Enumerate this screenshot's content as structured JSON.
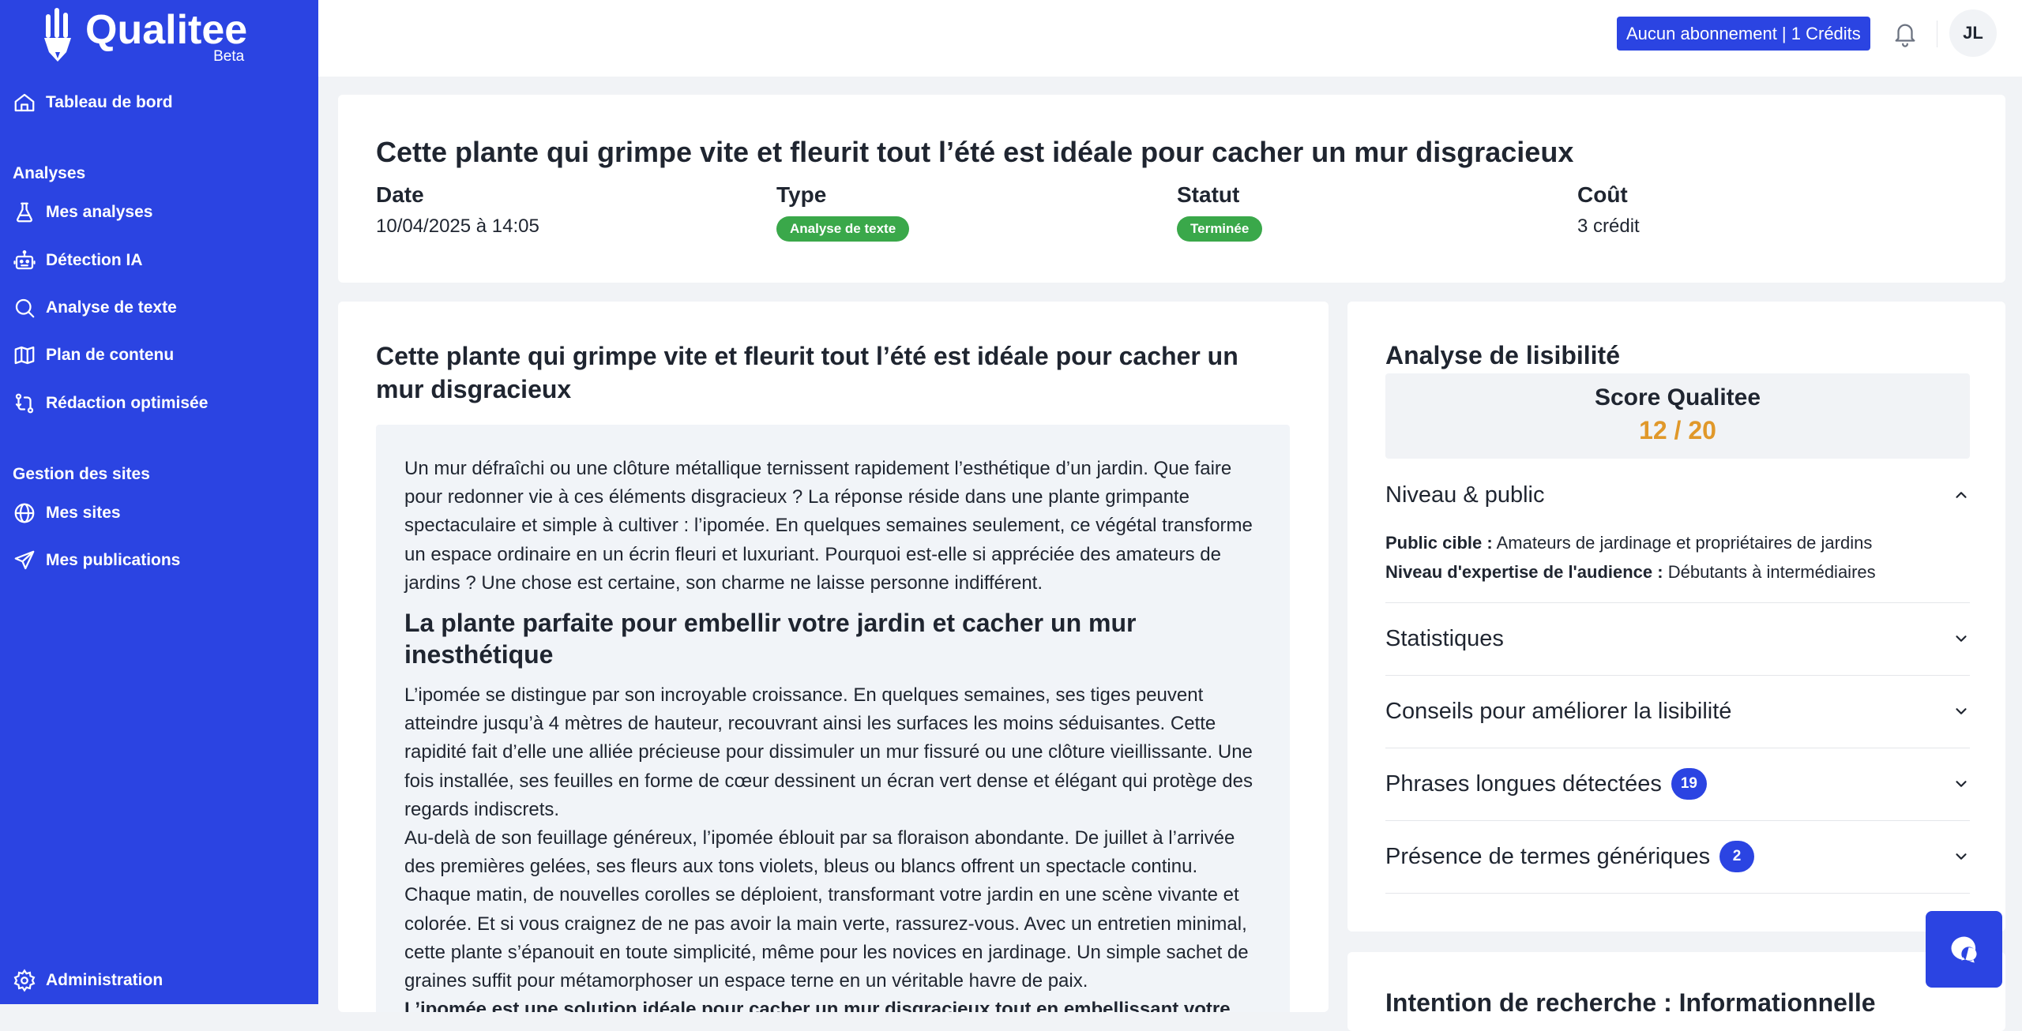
{
  "brand": {
    "name": "Qualitee",
    "tag": "Beta"
  },
  "colors": {
    "primary": "#2b44e2",
    "success": "#3aa84a",
    "score": "#e0982a"
  },
  "sidebar": {
    "dashboard": "Tableau de bord",
    "section_analyses": "Analyses",
    "analyses": [
      {
        "label": "Mes analyses",
        "icon": "flask-icon"
      },
      {
        "label": "Détection IA",
        "icon": "robot-icon"
      },
      {
        "label": "Analyse de texte",
        "icon": "search-icon"
      },
      {
        "label": "Plan de contenu",
        "icon": "map-icon"
      },
      {
        "label": "Rédaction optimisée",
        "icon": "route-icon"
      }
    ],
    "section_sites": "Gestion des sites",
    "sites": [
      {
        "label": "Mes sites",
        "icon": "globe-icon"
      },
      {
        "label": "Mes publications",
        "icon": "send-icon"
      }
    ],
    "admin": "Administration"
  },
  "topbar": {
    "subscription": "Aucun abonnement | 1 Crédits",
    "avatar_initials": "JL"
  },
  "header": {
    "title": "Cette plante qui grimpe vite et fleurit tout l’été est idéale pour cacher un mur disgracieux",
    "date_label": "Date",
    "date_value": "10/04/2025 à 14:05",
    "type_label": "Type",
    "type_value": "Analyse de texte",
    "status_label": "Statut",
    "status_value": "Terminée",
    "cost_label": "Coût",
    "cost_value": "3 crédit"
  },
  "content": {
    "title": "Cette plante qui grimpe vite et fleurit tout l’été est idéale pour cacher un mur disgracieux",
    "intro": "Un mur défraîchi ou une clôture métallique ternissent rapidement l’esthétique d’un jardin. Que faire pour redonner vie à ces éléments disgracieux ? La réponse réside dans une plante grimpante spectaculaire et simple à cultiver : l’ipomée. En quelques semaines seulement, ce végétal transforme un espace ordinaire en un écrin fleuri et luxuriant. Pourquoi est-elle si appréciée des amateurs de jardins ? Une chose est certaine, son charme ne laisse personne indifférent.",
    "heading1": "La plante parfaite pour embellir votre jardin et cacher un mur inesthétique",
    "para1": "L’ipomée se distingue par son incroyable croissance. En quelques semaines, ses tiges peuvent atteindre jusqu’à 4 mètres de hauteur, recouvrant ainsi les surfaces les moins séduisantes. Cette rapidité fait d’elle une alliée précieuse pour dissimuler un mur fissuré ou une clôture vieillissante. Une fois installée, ses feuilles en forme de cœur dessinent un écran vert dense et élégant qui protège des regards indiscrets.",
    "para2": "Au-delà de son feuillage généreux, l’ipomée éblouit par sa floraison abondante. De juillet à l’arrivée des premières gelées, ses fleurs aux tons violets, bleus ou blancs offrent un spectacle continu. Chaque matin, de nouvelles corolles se déploient, transformant votre jardin en une scène vivante et colorée. Et si vous craignez de ne pas avoir la main verte, rassurez-vous. Avec un entretien minimal, cette plante s’épanouit en toute simplicité, même pour les novices en jardinage. Un simple sachet de graines suffit pour métamorphoser un espace terne en un véritable havre de paix.",
    "para3": "L’ipomée est une solution idéale pour cacher un mur disgracieux tout en embellissant votre jardin."
  },
  "readability": {
    "title": "Analyse de lisibilité",
    "score_label": "Score Qualitee",
    "score_value": "12 / 20",
    "level_title": "Niveau & public",
    "audience_label": "Public cible :",
    "audience_value": "Amateurs de jardinage et propriétaires de jardins",
    "expertise_label": "Niveau d'expertise de l'audience :",
    "expertise_value": "Débutants à intermédiaires",
    "stats_title": "Statistiques",
    "tips_title": "Conseils pour améliorer la lisibilité",
    "long_title": "Phrases longues détectées",
    "long_count": "19",
    "generic_title": "Présence de termes génériques",
    "generic_count": "2"
  },
  "intent": {
    "title": "Intention de recherche : Informationnelle"
  }
}
